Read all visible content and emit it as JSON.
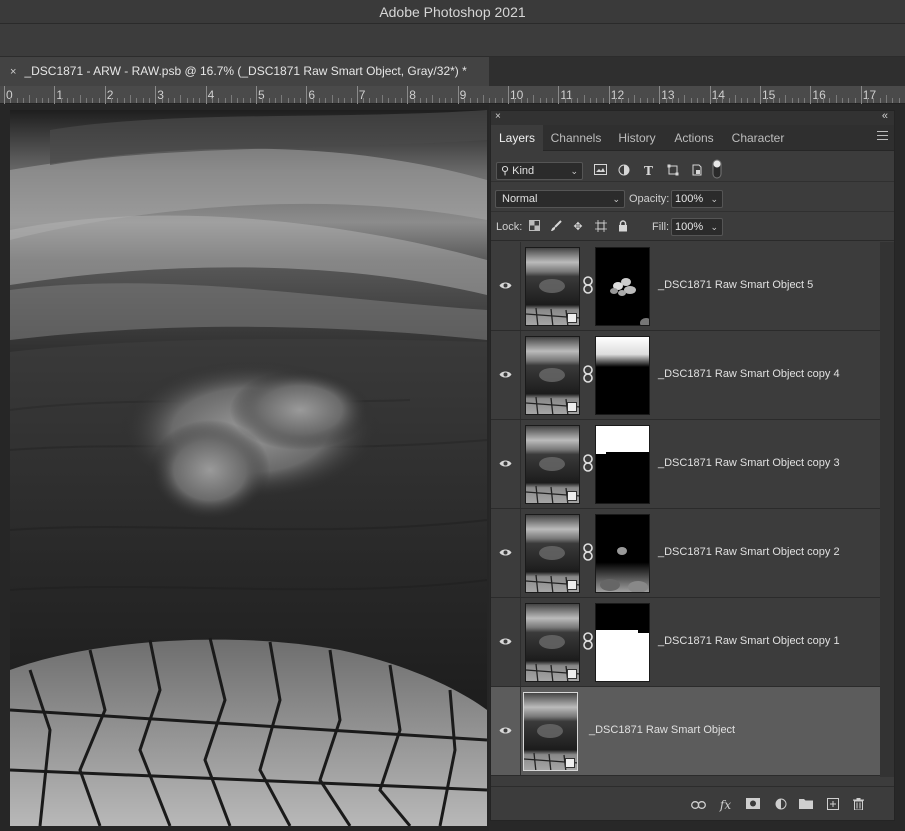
{
  "app_title": "Adobe Photoshop 2021",
  "document_tab": {
    "close_glyph": "×",
    "title": "_DSC1871 - ARW - RAW.psb @ 16.7% (_DSC1871 Raw Smart Object, Gray/32*) *"
  },
  "ruler": {
    "labels": [
      "0",
      "1",
      "2",
      "3",
      "4",
      "5",
      "6",
      "7",
      "8",
      "9",
      "10",
      "11",
      "12",
      "13",
      "14",
      "15",
      "16",
      "17"
    ]
  },
  "panel": {
    "close_glyph": "×",
    "collapse_glyph": "«",
    "tabs": [
      {
        "label": "Layers",
        "active": true
      },
      {
        "label": "Channels",
        "active": false
      },
      {
        "label": "History",
        "active": false
      },
      {
        "label": "Actions",
        "active": false
      },
      {
        "label": "Character",
        "active": false
      }
    ],
    "filter": {
      "kind_label": "Kind",
      "icons": [
        "image-filter-icon",
        "adjustment-filter-icon",
        "type-filter-icon",
        "shape-filter-icon",
        "smart-object-filter-icon",
        "filter-toggle-icon"
      ]
    },
    "blend_mode": "Normal",
    "opacity_label": "Opacity:",
    "opacity_value": "100%",
    "lock_label": "Lock:",
    "fill_label": "Fill:",
    "fill_value": "100%",
    "layers": [
      {
        "name": "_DSC1871 Raw Smart Object 5",
        "mask": "blobs",
        "selected": false
      },
      {
        "name": "_DSC1871 Raw Smart Object copy 4",
        "mask": "top-white",
        "selected": false
      },
      {
        "name": "_DSC1871 Raw Smart Object copy 3",
        "mask": "top-white-block",
        "selected": false
      },
      {
        "name": "_DSC1871 Raw Smart Object copy 2",
        "mask": "bottom-cloud",
        "selected": false
      },
      {
        "name": "_DSC1871 Raw Smart Object copy 1",
        "mask": "bottom-white",
        "selected": false
      },
      {
        "name": "_DSC1871 Raw Smart Object",
        "mask": "none",
        "selected": true
      }
    ],
    "footer_icons": [
      "link-layers-icon",
      "fx-icon",
      "add-mask-icon",
      "adjustment-layer-icon",
      "group-folder-icon",
      "new-layer-icon",
      "trash-icon"
    ]
  },
  "colors": {
    "panel_bg": "#3c3c3c",
    "selected_layer": "#5c5c5c",
    "tab_active": "#3c3c3c"
  }
}
